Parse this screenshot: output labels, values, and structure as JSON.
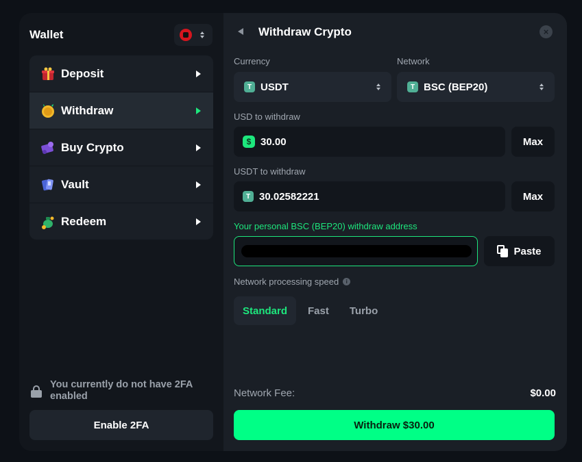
{
  "sidebar": {
    "title": "Wallet",
    "currency_flag": "albania-flag-icon",
    "items": [
      {
        "label": "Deposit",
        "icon": "gift-icon",
        "active": false
      },
      {
        "label": "Withdraw",
        "icon": "coin-icon",
        "active": true
      },
      {
        "label": "Buy Crypto",
        "icon": "card-icon",
        "active": false
      },
      {
        "label": "Vault",
        "icon": "vault-icon",
        "active": false
      },
      {
        "label": "Redeem",
        "icon": "money-bag-icon",
        "active": false
      }
    ],
    "twofa_note": "You currently do not have 2FA enabled",
    "enable_2fa_label": "Enable 2FA"
  },
  "panel": {
    "title": "Withdraw Crypto",
    "currency_label": "Currency",
    "currency_value": "USDT",
    "network_label": "Network",
    "network_value": "BSC (BEP20)",
    "usd_label": "USD to withdraw",
    "usd_symbol": "$",
    "usd_value": "30.00",
    "usdt_label": "USDT to withdraw",
    "usdt_value": "30.02582221",
    "coin_symbol": "T",
    "max_label": "Max",
    "address_label": "Your personal BSC (BEP20) withdraw address",
    "paste_label": "Paste",
    "speed_label": "Network processing speed",
    "speeds": [
      "Standard",
      "Fast",
      "Turbo"
    ],
    "selected_speed": "Standard",
    "fee_label": "Network Fee:",
    "fee_value": "$0.00",
    "withdraw_label": "Withdraw $30.00"
  },
  "colors": {
    "accent": "#1de77d",
    "button": "#00ff86",
    "panel_bg": "#1a1f26",
    "sidebar_bg": "#12161c"
  }
}
